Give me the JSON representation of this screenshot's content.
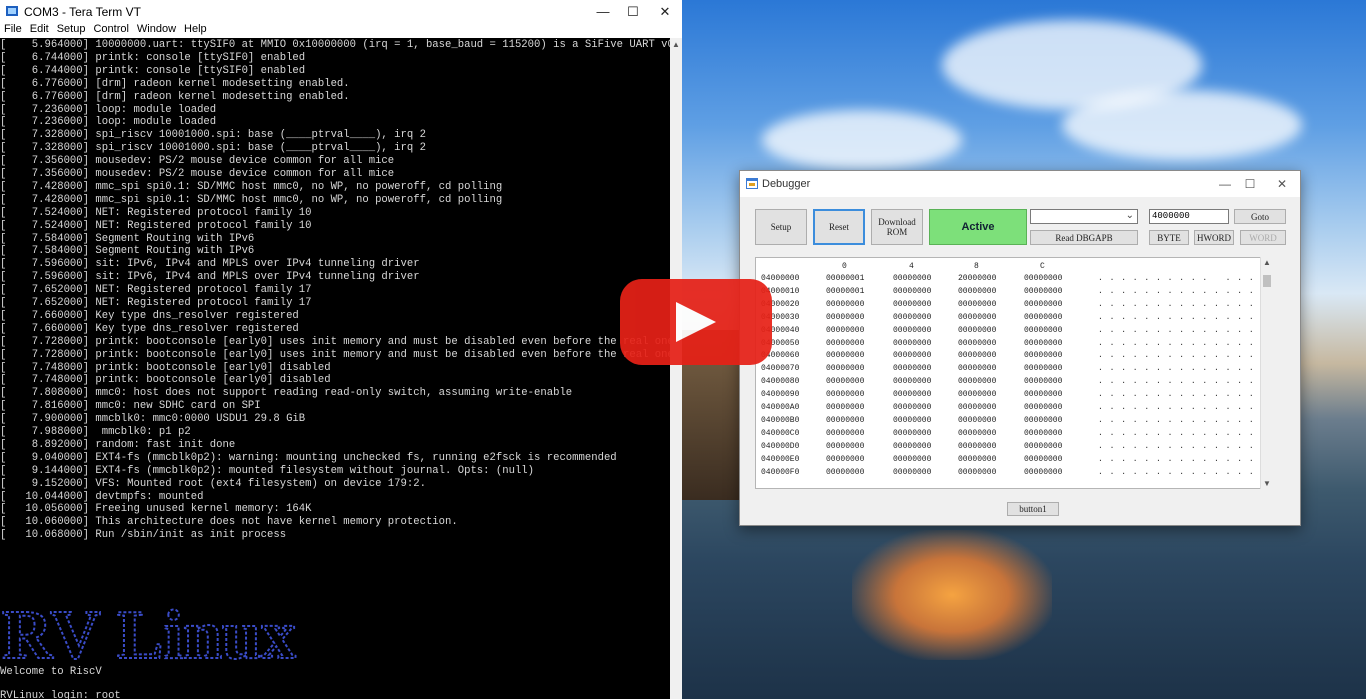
{
  "terminal": {
    "title": "COM3 - Tera Term VT",
    "menu": [
      "File",
      "Edit",
      "Setup",
      "Control",
      "Window",
      "Help"
    ],
    "lines": [
      "[    5.964000] 10000000.uart: ttySIF0 at MMIO 0x10000000 (irq = 1, base_baud = 115200) is a SiFive UART v0",
      "[    6.744000] printk: console [ttySIF0] enabled",
      "[    6.744000] printk: console [ttySIF0] enabled",
      "[    6.776000] [drm] radeon kernel modesetting enabled.",
      "[    6.776000] [drm] radeon kernel modesetting enabled.",
      "[    7.236000] loop: module loaded",
      "[    7.236000] loop: module loaded",
      "[    7.328000] spi_riscv 10001000.spi: base (____ptrval____), irq 2",
      "[    7.328000] spi_riscv 10001000.spi: base (____ptrval____), irq 2",
      "[    7.356000] mousedev: PS/2 mouse device common for all mice",
      "[    7.356000] mousedev: PS/2 mouse device common for all mice",
      "[    7.428000] mmc_spi spi0.1: SD/MMC host mmc0, no WP, no poweroff, cd polling",
      "[    7.428000] mmc_spi spi0.1: SD/MMC host mmc0, no WP, no poweroff, cd polling",
      "[    7.524000] NET: Registered protocol family 10",
      "[    7.524000] NET: Registered protocol family 10",
      "[    7.584000] Segment Routing with IPv6",
      "[    7.584000] Segment Routing with IPv6",
      "[    7.596000] sit: IPv6, IPv4 and MPLS over IPv4 tunneling driver",
      "[    7.596000] sit: IPv6, IPv4 and MPLS over IPv4 tunneling driver",
      "[    7.652000] NET: Registered protocol family 17",
      "[    7.652000] NET: Registered protocol family 17",
      "[    7.660000] Key type dns_resolver registered",
      "[    7.660000] Key type dns_resolver registered",
      "[    7.728000] printk: bootconsole [early0] uses init memory and must be disabled even before the real one is",
      "[    7.728000] printk: bootconsole [early0] uses init memory and must be disabled even before the real one is",
      "[    7.748000] printk: bootconsole [early0] disabled",
      "[    7.748000] printk: bootconsole [early0] disabled",
      "[    7.808000] mmc0: host does not support reading read-only switch, assuming write-enable",
      "[    7.816000] mmc0: new SDHC card on SPI",
      "[    7.900000] mmcblk0: mmc0:0000 USDU1 29.8 GiB",
      "[    7.988000]  mmcblk0: p1 p2",
      "[    8.892000] random: fast init done",
      "[    9.040000] EXT4-fs (mmcblk0p2): warning: mounting unchecked fs, running e2fsck is recommended",
      "[    9.144000] EXT4-fs (mmcblk0p2): mounted filesystem without journal. Opts: (null)",
      "[    9.152000] VFS: Mounted root (ext4 filesystem) on device 179:2.",
      "[   10.044000] devtmpfs: mounted",
      "[   10.056000] Freeing unused kernel memory: 164K",
      "[   10.060000] This architecture does not have kernel memory protection.",
      "[   10.068000] Run /sbin/init as init process"
    ],
    "banner": "RV Linux",
    "welcome": "Welcome to RiscV",
    "login": "RVLinux login: root"
  },
  "debugger": {
    "title": "Debugger",
    "buttons": {
      "setup": "Setup",
      "reset": "Reset",
      "download": "Download ROM",
      "active": "Active",
      "read": "Read DBGAPB",
      "goto": "Goto",
      "byte": "BYTE",
      "hword": "HWORD",
      "word": "WORD",
      "button1": "button1"
    },
    "address_input": "4000000",
    "dropdown_value": "",
    "columns": [
      "0",
      "4",
      "8",
      "C"
    ],
    "rows": [
      {
        "addr": "04000000",
        "v": [
          "00000001",
          "00000000",
          "20000000",
          "00000000"
        ]
      },
      {
        "addr": "04000010",
        "v": [
          "00000001",
          "00000000",
          "00000000",
          "00000000"
        ]
      },
      {
        "addr": "04000020",
        "v": [
          "00000000",
          "00000000",
          "00000000",
          "00000000"
        ]
      },
      {
        "addr": "04000030",
        "v": [
          "00000000",
          "00000000",
          "00000000",
          "00000000"
        ]
      },
      {
        "addr": "04000040",
        "v": [
          "00000000",
          "00000000",
          "00000000",
          "00000000"
        ]
      },
      {
        "addr": "04000050",
        "v": [
          "00000000",
          "00000000",
          "00000000",
          "00000000"
        ]
      },
      {
        "addr": "04000060",
        "v": [
          "00000000",
          "00000000",
          "00000000",
          "00000000"
        ]
      },
      {
        "addr": "04000070",
        "v": [
          "00000000",
          "00000000",
          "00000000",
          "00000000"
        ]
      },
      {
        "addr": "04000080",
        "v": [
          "00000000",
          "00000000",
          "00000000",
          "00000000"
        ]
      },
      {
        "addr": "04000090",
        "v": [
          "00000000",
          "00000000",
          "00000000",
          "00000000"
        ]
      },
      {
        "addr": "040000A0",
        "v": [
          "00000000",
          "00000000",
          "00000000",
          "00000000"
        ]
      },
      {
        "addr": "040000B0",
        "v": [
          "00000000",
          "00000000",
          "00000000",
          "00000000"
        ]
      },
      {
        "addr": "040000C0",
        "v": [
          "00000000",
          "00000000",
          "00000000",
          "00000000"
        ]
      },
      {
        "addr": "040000D0",
        "v": [
          "00000000",
          "00000000",
          "00000000",
          "00000000"
        ]
      },
      {
        "addr": "040000E0",
        "v": [
          "00000000",
          "00000000",
          "00000000",
          "00000000"
        ]
      },
      {
        "addr": "040000F0",
        "v": [
          "00000000",
          "00000000",
          "00000000",
          "00000000"
        ]
      }
    ],
    "ascii_first": ". . . . . . . . . .   . . . .",
    "ascii_other": ". . . . . . . . . . . . . . . ."
  },
  "colors": {
    "active_button": "#7de07a",
    "play_button": "#e62117",
    "terminal_bg": "#000000"
  },
  "icons": {
    "terminal": "tera-term-icon",
    "debugger": "debugger-app-icon",
    "play": "play-icon"
  }
}
